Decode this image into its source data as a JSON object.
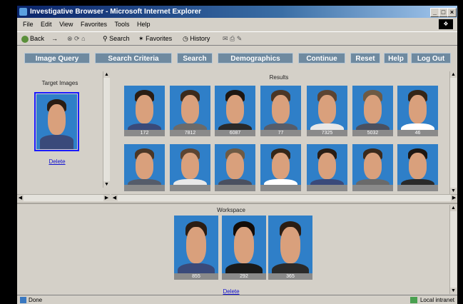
{
  "window": {
    "title": "Investigative Browser - Microsoft Internet Explorer",
    "controls": [
      "_",
      "□",
      "×"
    ]
  },
  "menu": [
    "File",
    "Edit",
    "View",
    "Favorites",
    "Tools",
    "Help"
  ],
  "toolbar": {
    "back": "Back",
    "forward": "→",
    "search": "Search",
    "favorites": "Favorites",
    "history": "History"
  },
  "nav": [
    "Image Query",
    "Search Criteria",
    "Search",
    "Demographics",
    "Continue",
    "Reset",
    "Help",
    "Log Out"
  ],
  "target": {
    "title": "Target Images",
    "delete_label": "Delete"
  },
  "results": {
    "title": "Results",
    "row1": [
      "172",
      "7812",
      "6087",
      "77",
      "7325",
      "5032",
      "46"
    ],
    "row2": [
      "",
      "",
      "",
      "",
      "",
      "",
      ""
    ]
  },
  "workspace": {
    "title": "Workspace",
    "ids": [
      "855",
      "292",
      "365"
    ],
    "delete_label": "Delete"
  },
  "status": {
    "text": "Done",
    "zone": "Local intranet"
  }
}
